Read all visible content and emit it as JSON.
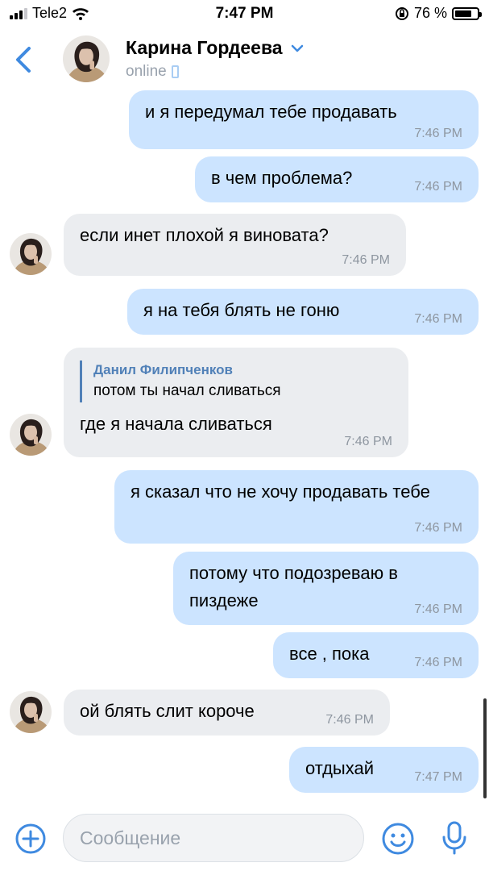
{
  "status_bar": {
    "carrier": "Tele2",
    "time": "7:47 PM",
    "battery": "76 %",
    "battery_level": 0.76
  },
  "header": {
    "name": "Карина Гордеева",
    "status": "online"
  },
  "messages": [
    {
      "dir": "out",
      "text": "и я передумал тебе продавать",
      "time": "7:46 PM"
    },
    {
      "dir": "out",
      "text": "в чем проблема?",
      "time": "7:46 PM"
    },
    {
      "dir": "in",
      "text": "если инет плохой я виновата?",
      "time": "7:46 PM"
    },
    {
      "dir": "out",
      "text": "я на тебя блять не гоню",
      "time": "7:46 PM"
    },
    {
      "dir": "in",
      "reply_author": "Данил Филипченков",
      "reply_text": "потом ты начал сливаться",
      "text": "где я начала сливаться",
      "time": "7:46 PM"
    },
    {
      "dir": "out",
      "text": "я сказал что не хочу продавать тебе",
      "time": "7:46 PM"
    },
    {
      "dir": "out",
      "text": "потому что подозреваю в пиздеже",
      "time": "7:46 PM"
    },
    {
      "dir": "out",
      "text": "все , пока",
      "time": "7:46 PM"
    },
    {
      "dir": "in",
      "text": "ой блять слит короче",
      "time": "7:46 PM"
    },
    {
      "dir": "out",
      "text": "отдыхай",
      "time": "7:47 PM"
    }
  ],
  "composer": {
    "placeholder": "Сообщение"
  },
  "colors": {
    "accent": "#3f8ae0",
    "outgoing_bubble": "#cce4ff",
    "incoming_bubble": "#ebedf0"
  },
  "icons": [
    "back-arrow-icon",
    "chevron-down-icon",
    "phone-icon",
    "plus-icon",
    "smile-icon",
    "mic-icon"
  ]
}
